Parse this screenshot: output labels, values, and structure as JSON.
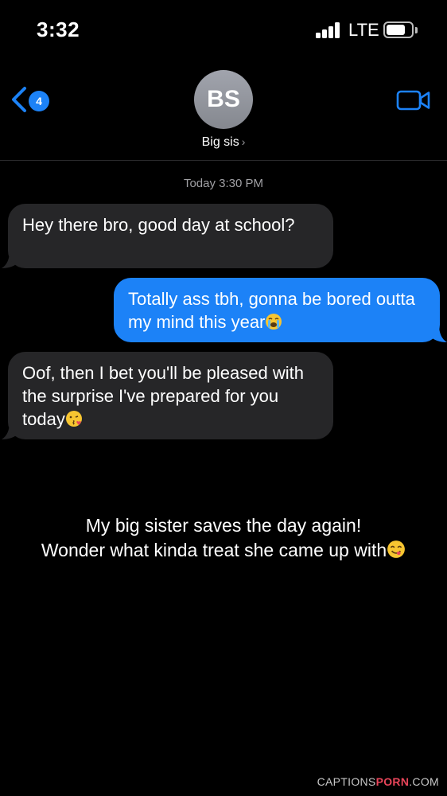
{
  "status_bar": {
    "time": "3:32",
    "network": "LTE",
    "battery_level": 0.78
  },
  "header": {
    "unread_count": "4",
    "avatar_initials": "BS",
    "contact_name": "Big sis",
    "accent_color": "#1c82f7",
    "icons": [
      "chevron-left-icon",
      "video-camera-icon",
      "chevron-right-icon"
    ]
  },
  "thread": {
    "timestamp": "Today 3:30 PM",
    "messages": [
      {
        "direction": "incoming",
        "text": "Hey there bro, good day at school?"
      },
      {
        "direction": "outgoing",
        "text": "Totally ass tbh, gonna be bored outta my mind this year",
        "emoji": "loudly-crying-face"
      },
      {
        "direction": "incoming",
        "text": "Oof, then I bet you'll be pleased with the surprise I've prepared for you today",
        "emoji": "face-blowing-kiss"
      }
    ]
  },
  "caption": {
    "line1": "My big sister saves the day again!",
    "line2": "Wonder what kinda treat she came up with",
    "emoji": "face-savoring-food"
  },
  "watermark": {
    "prefix": "CAPTIONS",
    "brand": "PORN",
    "suffix": ".COM"
  }
}
